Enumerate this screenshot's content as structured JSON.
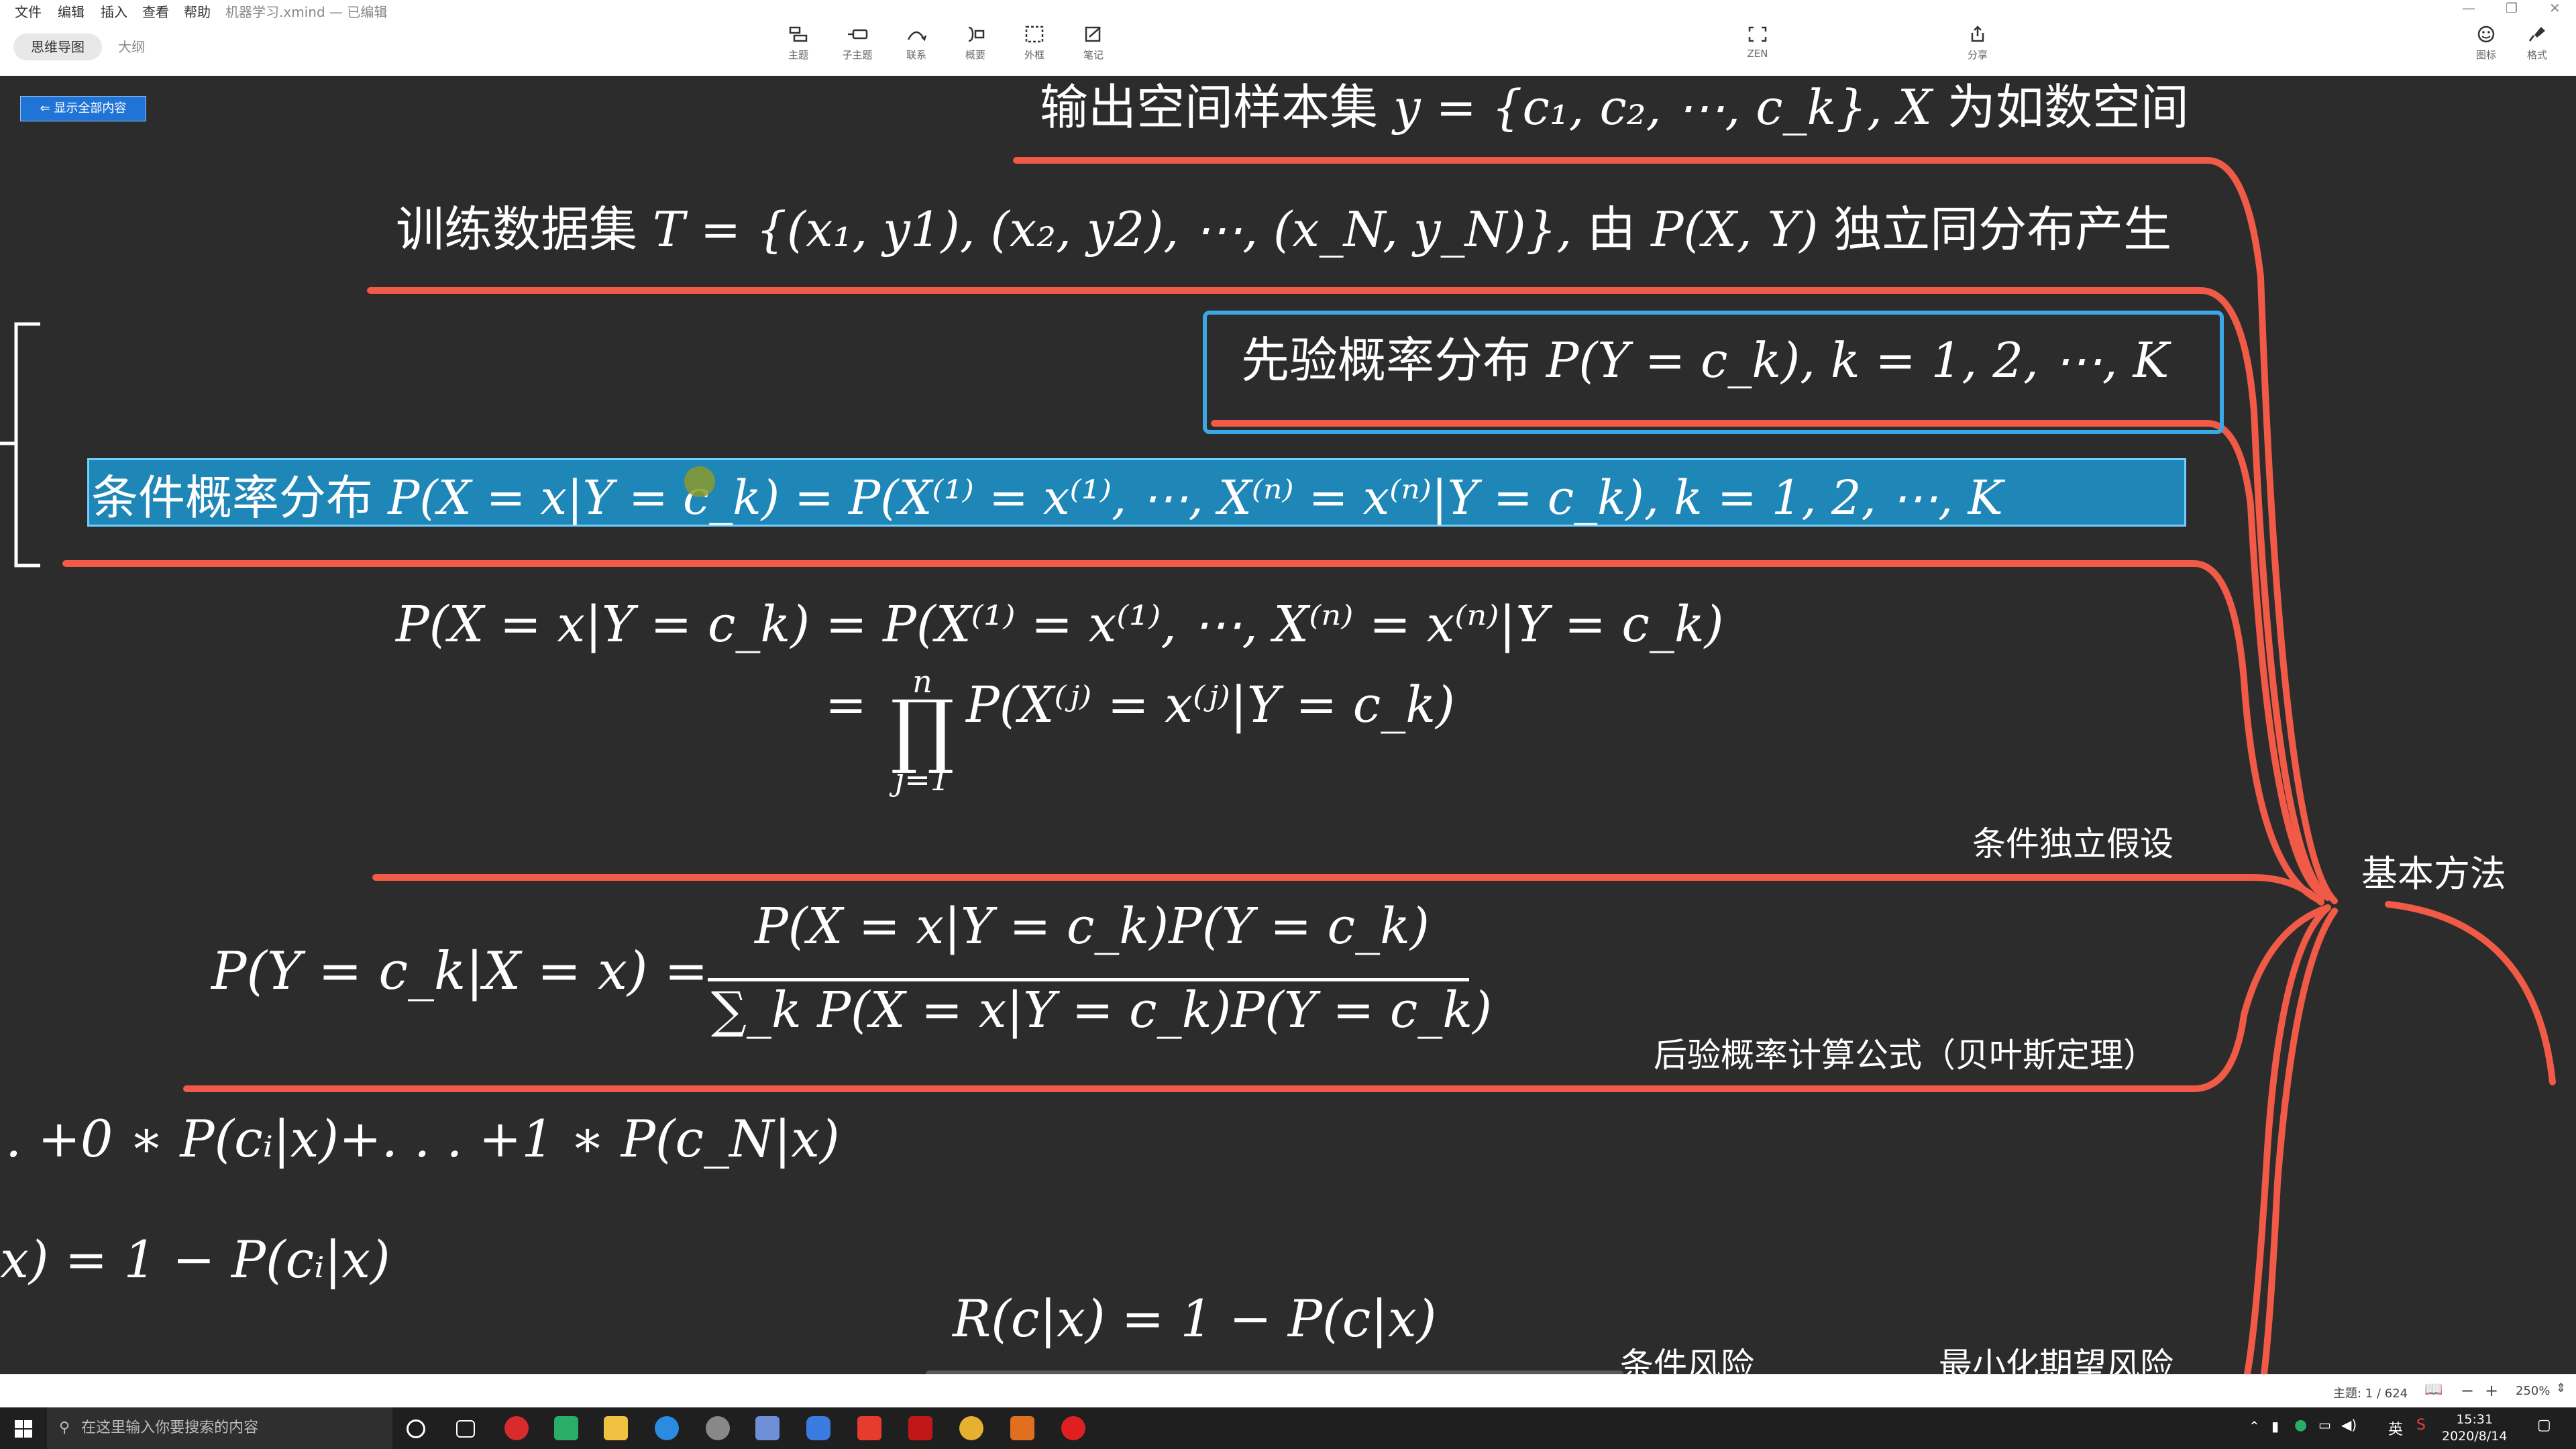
{
  "menubar": {
    "items": [
      "文件",
      "编辑",
      "插入",
      "查看",
      "帮助"
    ],
    "doc_title": "机器学习.xmind — 已编辑"
  },
  "toolbar": {
    "buttons": [
      "主题",
      "子主题",
      "联系",
      "概要",
      "外框",
      "笔记"
    ],
    "zen": "ZEN",
    "share": "分享",
    "icons_label": "图标",
    "format_label": "格式"
  },
  "view_tabs": {
    "mindmap": "思维导图",
    "outline": "大纲"
  },
  "canvas": {
    "show_all_button": "显示全部内容",
    "topics": {
      "output_space": {
        "cn": "输出空间样本集",
        "math": "y = {c₁, c₂, ⋯, c_k}, X",
        "tail": "为如数空间"
      },
      "training_set": {
        "cn": "训练数据集",
        "math": "T = {(x₁, y1), (x₂, y2), ⋯, (x_N, y_N)},",
        "mid": "由",
        "math2": "P(X, Y)",
        "tail": "独立同分布产生"
      },
      "prior": {
        "cn": "先验概率分布",
        "math": "P(Y = c_k), k = 1, 2, ⋯, K"
      },
      "conditional": {
        "cn": "条件概率分布",
        "math": "P(X = x|Y = c_k) = P(X⁽¹⁾ = x⁽¹⁾, ⋯, X⁽ⁿ⁾ = x⁽ⁿ⁾|Y = c_k), k = 1, 2, ⋯, K"
      },
      "independence_line1": "P(X = x|Y = c_k) = P(X⁽¹⁾ = x⁽¹⁾, ⋯, X⁽ⁿ⁾ = x⁽ⁿ⁾|Y = c_k)",
      "independence_line2_eq": "=",
      "independence_line2_rest": "P(X⁽ʲ⁾ = x⁽ʲ⁾|Y = c_k)",
      "prod_upper": "n",
      "prod_lower": "j=1",
      "independence_label": "条件独立假设",
      "bayes_lhs": "P(Y = c_k|X = x) =",
      "bayes_num": "P(X = x|Y = c_k)P(Y = c_k)",
      "bayes_den": "∑_k P(X = x|Y = c_k)P(Y = c_k)",
      "bayes_label": "后验概率计算公式（贝叶斯定理）",
      "partial1": ". +0 ∗ P(cᵢ|x)+. . . +1 ∗ P(c_N|x)",
      "partial2": "x) = 1 − P(cᵢ|x)",
      "risk": "R(c|x) = 1 − P(c|x)",
      "cond_risk_label": "条件风险",
      "min_risk_label": "最小化期望风险",
      "basic_method": "基本方法"
    }
  },
  "statusbar": {
    "topic_count": "主题: 1 / 624",
    "zoom": "250%",
    "minus": "−",
    "plus": "+"
  },
  "taskbar": {
    "search_placeholder": "在这里输入你要搜索的内容",
    "ime": "英",
    "time": "15:31",
    "date": "2020/8/14"
  },
  "colors": {
    "branch": "#f05a46",
    "selection": "#3aa7e6",
    "canvas": "#2c2c2c"
  }
}
